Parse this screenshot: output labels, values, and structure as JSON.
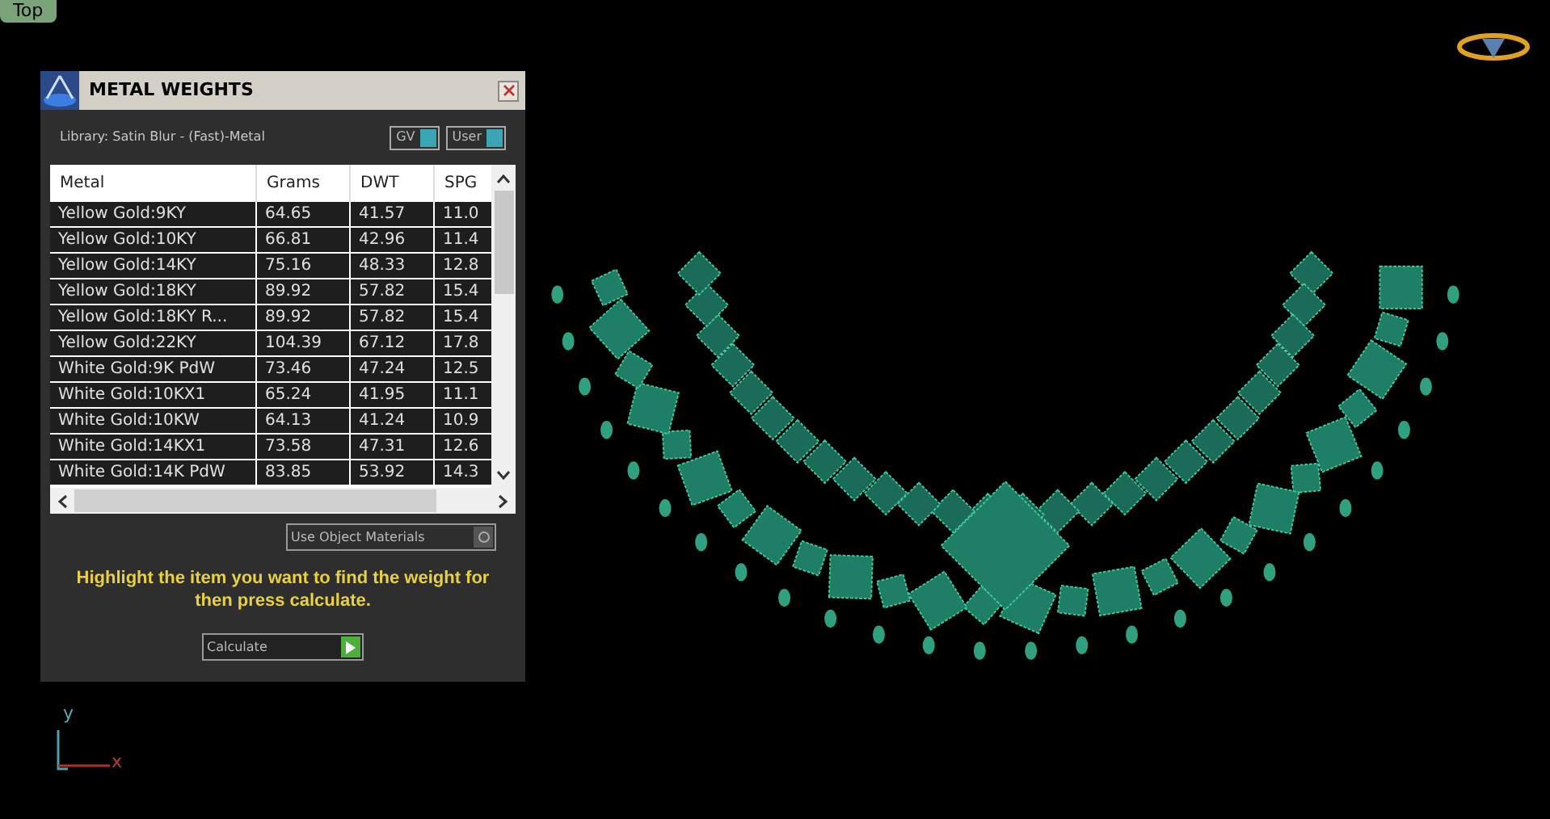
{
  "viewport": {
    "label": "Top",
    "axis_y": "y",
    "axis_x": "x"
  },
  "panel": {
    "title": "METAL WEIGHTS",
    "library": "Library: Satin Blur - (Fast)-Metal",
    "toggles": [
      {
        "label": "GV",
        "on": true
      },
      {
        "label": "User",
        "on": true
      }
    ],
    "table": {
      "columns": [
        "Metal",
        "Grams",
        "DWT",
        "SPG"
      ],
      "rows": [
        [
          "Yellow Gold:9KY",
          "64.65",
          "41.57",
          "11.0"
        ],
        [
          "Yellow Gold:10KY",
          "66.81",
          "42.96",
          "11.4"
        ],
        [
          "Yellow Gold:14KY",
          "75.16",
          "48.33",
          "12.8"
        ],
        [
          "Yellow Gold:18KY",
          "89.92",
          "57.82",
          "15.4"
        ],
        [
          "Yellow Gold:18KY R...",
          "89.92",
          "57.82",
          "15.4"
        ],
        [
          "Yellow Gold:22KY",
          "104.39",
          "67.12",
          "17.8"
        ],
        [
          "White Gold:9K PdW",
          "73.46",
          "47.24",
          "12.5"
        ],
        [
          "White Gold:10KX1",
          "65.24",
          "41.95",
          "11.1"
        ],
        [
          "White Gold:10KW",
          "64.13",
          "41.24",
          "10.9"
        ],
        [
          "White Gold:14KX1",
          "73.58",
          "47.31",
          "12.6"
        ],
        [
          "White Gold:14K PdW",
          "83.85",
          "53.92",
          "14.3"
        ]
      ]
    },
    "use_object_materials": {
      "label": "Use Object Materials",
      "checked": false
    },
    "hint": "Highlight the item you want to find the weight for then press calculate.",
    "calculate": "Calculate"
  }
}
